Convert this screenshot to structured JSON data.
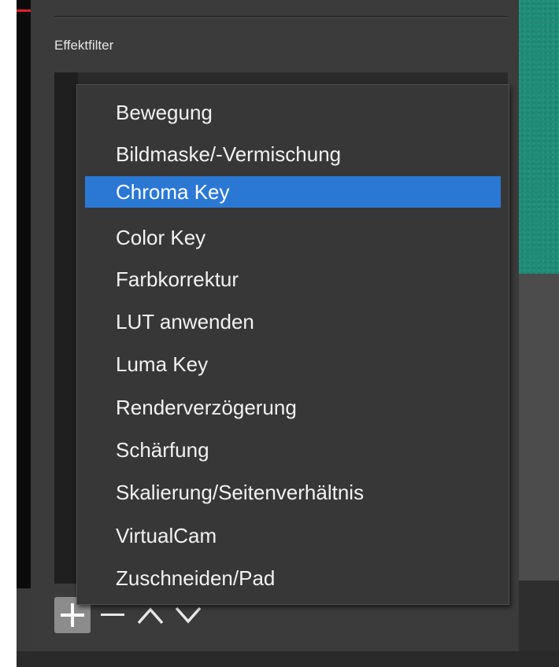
{
  "dock": {
    "title": "Effektfilter"
  },
  "menu": {
    "selected_index": 2,
    "items": [
      {
        "label": "Bewegung"
      },
      {
        "label": "Bildmaske/-Vermischung"
      },
      {
        "label": "Chroma Key"
      },
      {
        "label": "Color Key"
      },
      {
        "label": "Farbkorrektur"
      },
      {
        "label": "LUT anwenden"
      },
      {
        "label": "Luma Key"
      },
      {
        "label": "Renderverzögerung"
      },
      {
        "label": "Schärfung"
      },
      {
        "label": "Skalierung/Seitenverhältnis"
      },
      {
        "label": "VirtualCam"
      },
      {
        "label": "Zuschneiden/Pad"
      }
    ]
  },
  "toolbar": {
    "buttons": [
      "plus-icon",
      "minus-icon",
      "chevron-up-icon",
      "chevron-down-icon"
    ]
  },
  "colors": {
    "accent": "#2b78d4",
    "panel": "#3b3b3b",
    "menu": "#373737",
    "preview": "#1f8c78"
  }
}
